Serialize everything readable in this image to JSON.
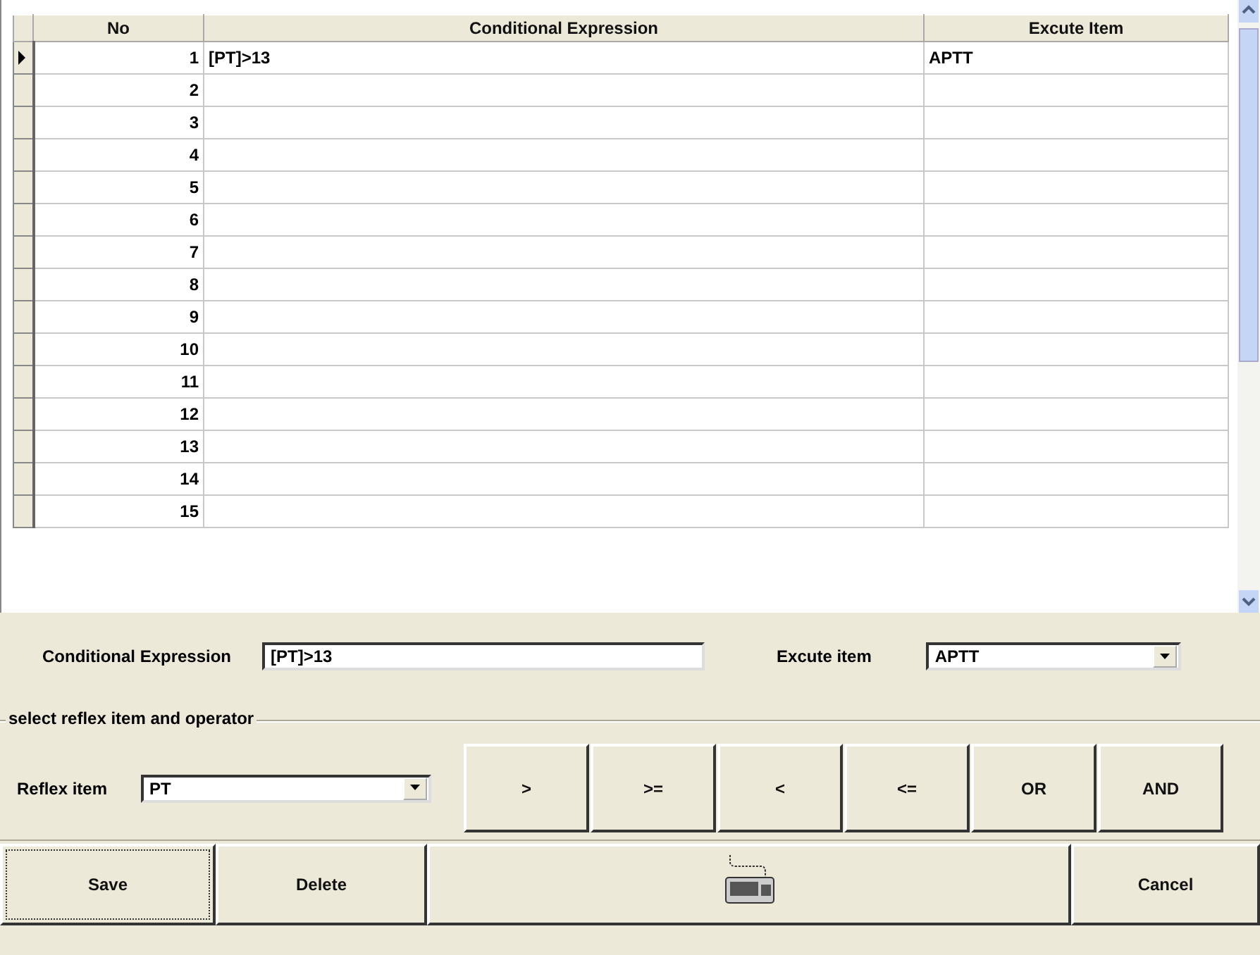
{
  "table": {
    "columns": [
      "No",
      "Conditional Expression",
      "Excute Item"
    ],
    "rows": [
      {
        "no": "1",
        "expression": "[PT]>13",
        "item": "APTT",
        "selected": true
      },
      {
        "no": "2",
        "selected": false
      },
      {
        "no": "3",
        "selected": false
      },
      {
        "no": "4",
        "selected": false
      },
      {
        "no": "5",
        "selected": false
      },
      {
        "no": "6",
        "selected": false
      },
      {
        "no": "7",
        "selected": false
      },
      {
        "no": "8",
        "selected": false
      },
      {
        "no": "9",
        "selected": false
      },
      {
        "no": "10",
        "selected": false
      },
      {
        "no": "11",
        "selected": false
      },
      {
        "no": "12",
        "selected": false
      },
      {
        "no": "13",
        "selected": false
      },
      {
        "no": "14",
        "selected": false
      },
      {
        "no": "15",
        "selected": false
      }
    ]
  },
  "editor": {
    "expression_label": "Conditional Expression",
    "expression_value": "[PT]>13",
    "execute_label": "Excute item",
    "execute_value": "APTT"
  },
  "reflex": {
    "group_title": "select reflex item and operator",
    "item_label": "Reflex item",
    "item_value": "PT",
    "operators": [
      ">",
      ">=",
      "<",
      "<=",
      "OR",
      "AND"
    ]
  },
  "actions": [
    {
      "kind": "text",
      "label": "Save"
    },
    {
      "kind": "text",
      "label": "Delete"
    },
    {
      "kind": "keyboard"
    },
    {
      "kind": "text",
      "label": "Cancel"
    }
  ]
}
